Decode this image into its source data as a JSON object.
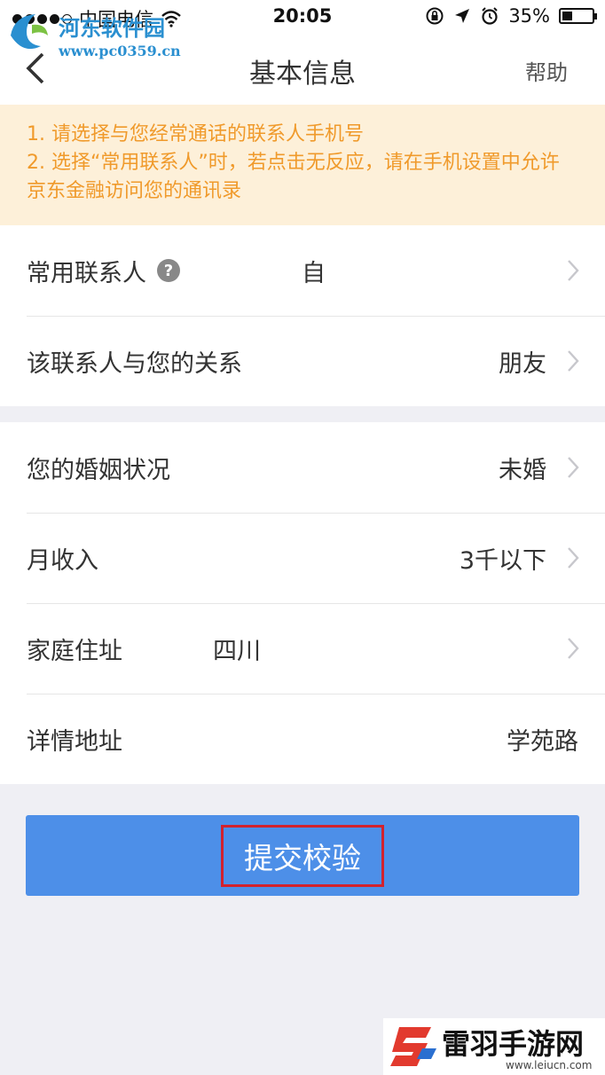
{
  "status_bar": {
    "carrier": "中国电信",
    "time": "20:05",
    "battery": "35%",
    "battery_level": 0.35
  },
  "watermark_top": {
    "title": "河东软件园",
    "url": "www.pc0359.cn"
  },
  "nav": {
    "title": "基本信息",
    "help": "帮助"
  },
  "notice": {
    "line1": "1. 请选择与您经常通话的联系人手机号",
    "line2": "2. 选择“常用联系人”时，若点击无反应，请在手机设置中允许京东金融访问您的通讯录"
  },
  "group1": {
    "contact_label": "常用联系人",
    "contact_help_icon": "?",
    "contact_value": "自",
    "relation_label": "该联系人与您的关系",
    "relation_value": "朋友"
  },
  "group2": {
    "marital_label": "您的婚姻状况",
    "marital_value": "未婚",
    "income_label": "月收入",
    "income_value": "3千以下",
    "home_label": "家庭住址",
    "home_value": "四川",
    "detail_label": "详情地址",
    "detail_value": "学苑路"
  },
  "submit": {
    "label": "提交校验"
  },
  "watermark_bottom": {
    "name": "雷羽手游网",
    "url": "www.leiucn.com"
  },
  "colors": {
    "accent": "#4d8fe8",
    "notice_text": "#f09a2b",
    "notice_bg": "#fdf0d9",
    "highlight_box": "#d2222d"
  }
}
